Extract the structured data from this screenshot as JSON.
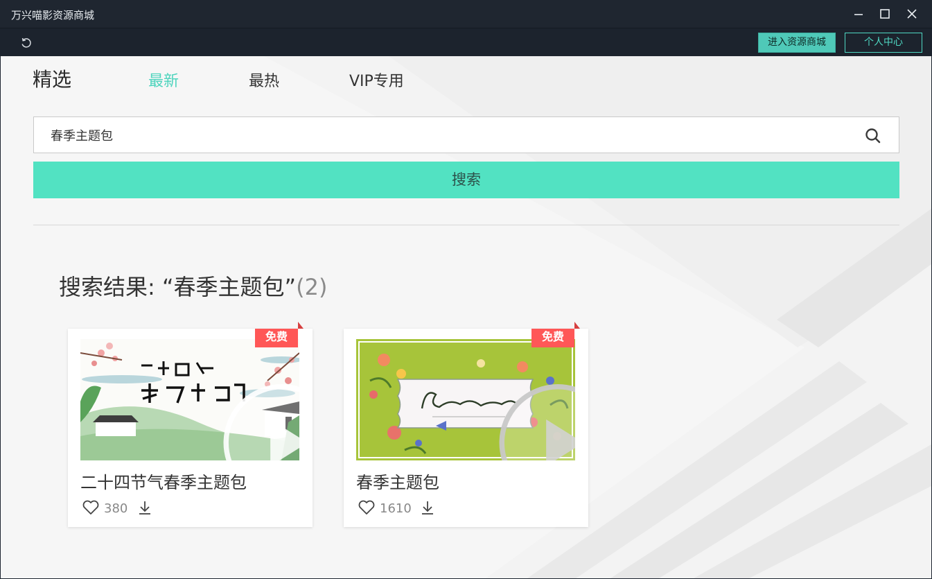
{
  "window": {
    "title": "万兴喵影资源商城"
  },
  "toolbar": {
    "store_button": "进入资源商城",
    "user_button": "个人中心"
  },
  "tabs": {
    "featured": "精选",
    "newest": "最新",
    "hot": "最热",
    "vip": "VIP专用"
  },
  "search": {
    "value": "春季主题包",
    "button_label": "搜索"
  },
  "results": {
    "label": "搜索结果: “春季主题包”",
    "count": "(2)"
  },
  "cards": [
    {
      "badge": "免费",
      "title": "二十四节气春季主题包",
      "likes": "380"
    },
    {
      "badge": "免费",
      "title": "春季主题包",
      "likes": "1610"
    }
  ],
  "colors": {
    "accent": "#52e2c2",
    "active_tab": "#4ed4bd",
    "badge": "#ff5757",
    "titlebar": "#1f2630"
  },
  "icons": [
    "minimize-icon",
    "maximize-icon",
    "close-icon",
    "refresh-icon",
    "search-icon",
    "play-icon",
    "heart-icon",
    "download-icon"
  ]
}
